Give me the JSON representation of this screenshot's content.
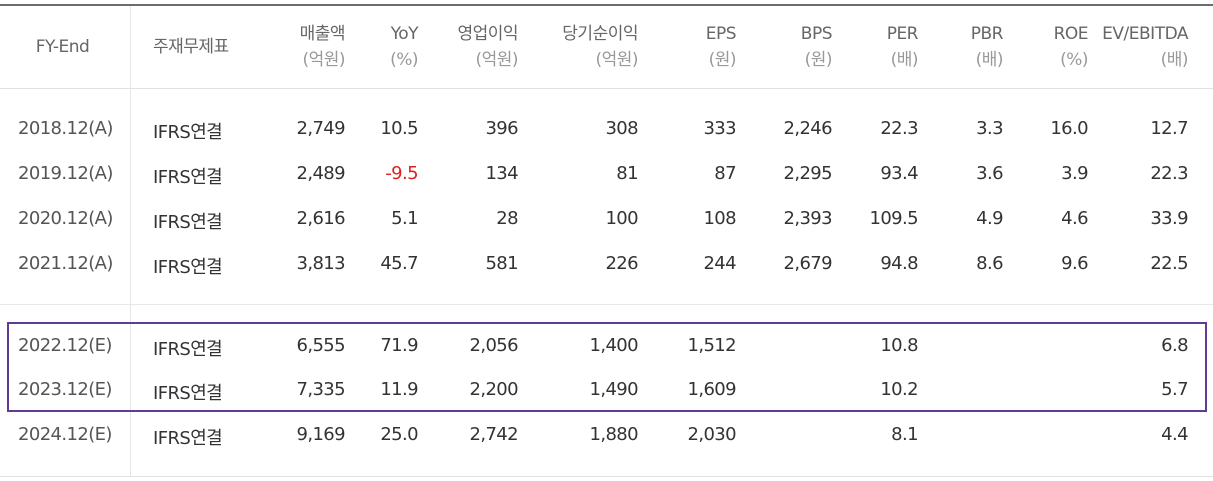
{
  "colors": {
    "header_text": "#666666",
    "body_text": "#333333",
    "negative": "#e02020",
    "highlight_border": "#5f3a99"
  },
  "headers": [
    {
      "l1": "FY-End",
      "l2": ""
    },
    {
      "l1": "주재무제표",
      "l2": ""
    },
    {
      "l1": "매출액",
      "l2": "(억원)"
    },
    {
      "l1": "YoY",
      "l2": "(%)"
    },
    {
      "l1": "영업이익",
      "l2": "(억원)"
    },
    {
      "l1": "당기순이익",
      "l2": "(억원)"
    },
    {
      "l1": "EPS",
      "l2": "(원)"
    },
    {
      "l1": "BPS",
      "l2": "(원)"
    },
    {
      "l1": "PER",
      "l2": "(배)"
    },
    {
      "l1": "PBR",
      "l2": "(배)"
    },
    {
      "l1": "ROE",
      "l2": "(%)"
    },
    {
      "l1": "EV/EBITDA",
      "l2": "(배)"
    }
  ],
  "rows": [
    [
      "2018.12(A)",
      "IFRS연결",
      "2,749",
      "10.5",
      "396",
      "308",
      "333",
      "2,246",
      "22.3",
      "3.3",
      "16.0",
      "12.7"
    ],
    [
      "2019.12(A)",
      "IFRS연결",
      "2,489",
      "-9.5",
      "134",
      "81",
      "87",
      "2,295",
      "93.4",
      "3.6",
      "3.9",
      "22.3"
    ],
    [
      "2020.12(A)",
      "IFRS연결",
      "2,616",
      "5.1",
      "28",
      "100",
      "108",
      "2,393",
      "109.5",
      "4.9",
      "4.6",
      "33.9"
    ],
    [
      "2021.12(A)",
      "IFRS연결",
      "3,813",
      "45.7",
      "581",
      "226",
      "244",
      "2,679",
      "94.8",
      "8.6",
      "9.6",
      "22.5"
    ],
    [
      "2022.12(E)",
      "IFRS연결",
      "6,555",
      "71.9",
      "2,056",
      "1,400",
      "1,512",
      "",
      "10.8",
      "",
      "",
      "6.8"
    ],
    [
      "2023.12(E)",
      "IFRS연결",
      "7,335",
      "11.9",
      "2,200",
      "1,490",
      "1,609",
      "",
      "10.2",
      "",
      "",
      "5.7"
    ],
    [
      "2024.12(E)",
      "IFRS연결",
      "9,169",
      "25.0",
      "2,742",
      "1,880",
      "2,030",
      "",
      "8.1",
      "",
      "",
      "4.4"
    ]
  ]
}
